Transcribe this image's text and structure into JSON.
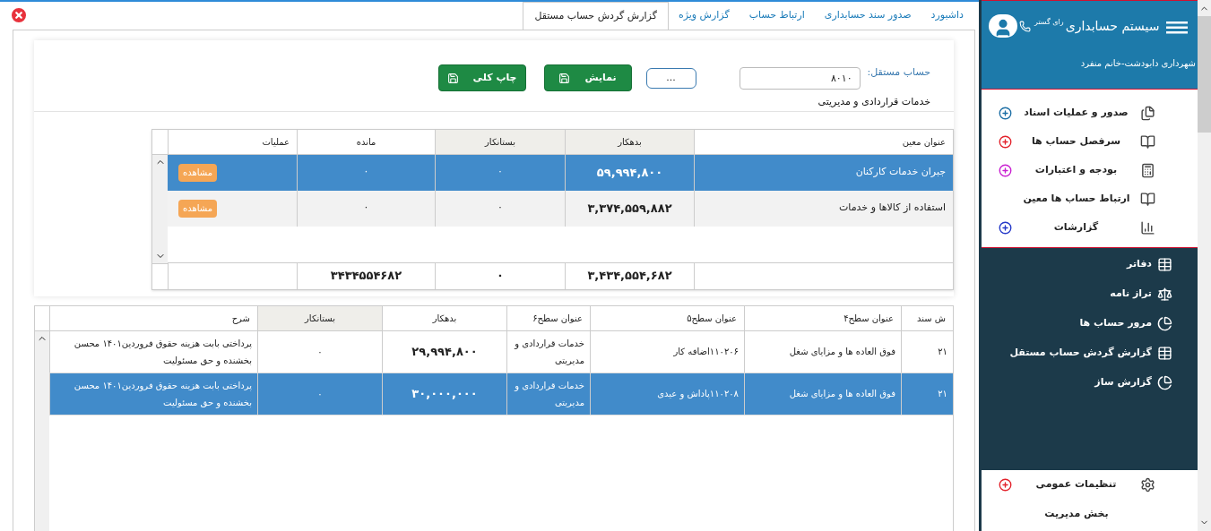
{
  "tabs": [
    {
      "label": "داشبورد",
      "selected": false
    },
    {
      "label": "صدور سند حسابداری",
      "selected": false
    },
    {
      "label": "ارتباط حساب",
      "selected": false
    },
    {
      "label": "گزارش ویژه",
      "selected": false
    },
    {
      "label": "گزارش گردش حساب مستقل",
      "selected": true
    }
  ],
  "form": {
    "label": "حساب مستقل:",
    "value": "۸۰۱۰",
    "browse_button": "...",
    "buttons": [
      "نمایش",
      "چاپ کلی"
    ],
    "account_name": "خدمات قراردادی و مدیریتی"
  },
  "summary_table": {
    "columns": [
      "عنوان معین",
      "بدهکار",
      "بستانکار",
      "مانده",
      "عملیات"
    ],
    "rows": [
      {
        "selected": true,
        "cells": [
          "جبران خدمات کارکنان",
          "۵۹,۹۹۴,۸۰۰",
          "۰",
          "۰"
        ],
        "action": "مشاهده"
      },
      {
        "selected": false,
        "cells": [
          "استفاده از کالاها و خدمات",
          "۳,۳۷۴,۵۵۹,۸۸۲",
          "۰",
          "۰"
        ],
        "action": "مشاهده"
      }
    ],
    "totals": [
      "۳,۴۳۴,۵۵۴,۶۸۲",
      "۰",
      "۳۴۳۴۵۵۴۶۸۲"
    ]
  },
  "detail_table": {
    "columns": [
      "ش سند",
      "عنوان سطح۴",
      "عنوان سطح۵",
      "عنوان سطح۶",
      "بدهکار",
      "بستانکار",
      "شرح"
    ],
    "rows": [
      {
        "selected": false,
        "cells": [
          "۲۱",
          "فوق العاده ها و مزایای شغل",
          "۱۱۰۲۰۶اضافه کار",
          "خدمات قراردادی و مدیریتی",
          "۲۹,۹۹۴,۸۰۰",
          "۰",
          "پرداختی بابت هزینه حقوق فروردین۱۴۰۱ محسن بخشنده و حق مسئولیت"
        ]
      },
      {
        "selected": true,
        "cells": [
          "۲۱",
          "فوق العاده ها و مزایای شغل",
          "۱۱۰۲۰۸پاداش و عیدی",
          "خدمات قراردادی و مدیریتی",
          "۳۰,۰۰۰,۰۰۰",
          "۰",
          "پرداختی بابت هزینه حقوق فروردین۱۴۰۱ محسن بخشنده و حق مسئولیت"
        ]
      }
    ]
  },
  "sidebar": {
    "title": "سیستم حسابداری",
    "brand": "رای گستر",
    "subtitle": "شهرداری دابودشت-خانم منفرد",
    "menu": [
      {
        "label": "صدور و عملیات اسناد",
        "color": "#1d6fa5"
      },
      {
        "label": "سرفصل حساب ها",
        "color": "#e3232c"
      },
      {
        "label": "بودجه و اعتبارات",
        "color": "#c81fd0"
      },
      {
        "label": "ارتباط حساب ها معین"
      },
      {
        "label": "گزارشات",
        "color": "#2438c8"
      }
    ],
    "submenu": [
      "دفاتر",
      "تراز نامه",
      "مرور حساب ها",
      "گزارش گردش حساب مستقل",
      "گزارش ساز"
    ],
    "bottom_menu": [
      {
        "label": "تنظیمات عمومی",
        "color": "#e3232c"
      },
      {
        "label": "بخش مدیریت"
      }
    ]
  }
}
